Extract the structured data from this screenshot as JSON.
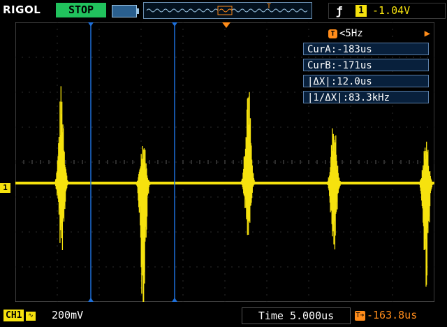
{
  "header": {
    "brand": "RIGOL",
    "run_status": "STOP",
    "trigger_edge_icon": "rising-edge-icon",
    "trigger_source": "1",
    "trigger_level": "-1.04V"
  },
  "cursor_panel": {
    "frequency": "<5Hz",
    "cur_a": "CurA:-183us",
    "cur_b": "CurB:-171us",
    "delta_x": "|ΔX|:12.0us",
    "inv_delta_x": "|1/ΔX|:83.3kHz"
  },
  "footer": {
    "channel": "CH1",
    "volts_per_div": "200mV",
    "timebase": "Time 5.000us",
    "trigger_offset": "-163.8us"
  },
  "colors": {
    "channel1": "#f6e20e",
    "cursor": "#1e6fd9",
    "trigger": "#ff8c1a",
    "grid": "#5a5a5a"
  },
  "waveform": {
    "channel": "CH1",
    "bursts": [
      {
        "center_div": 1.1,
        "amp_up_div": 2.9,
        "amp_down_div": 2.1
      },
      {
        "center_div": 3.05,
        "amp_up_div": 1.4,
        "amp_down_div": 3.9
      },
      {
        "center_div": 5.55,
        "amp_up_div": 3.3,
        "amp_down_div": 1.6
      },
      {
        "center_div": 7.6,
        "amp_up_div": 2.0,
        "amp_down_div": 2.4
      },
      {
        "center_div": 9.8,
        "amp_up_div": 1.4,
        "amp_down_div": 3.1
      }
    ]
  }
}
